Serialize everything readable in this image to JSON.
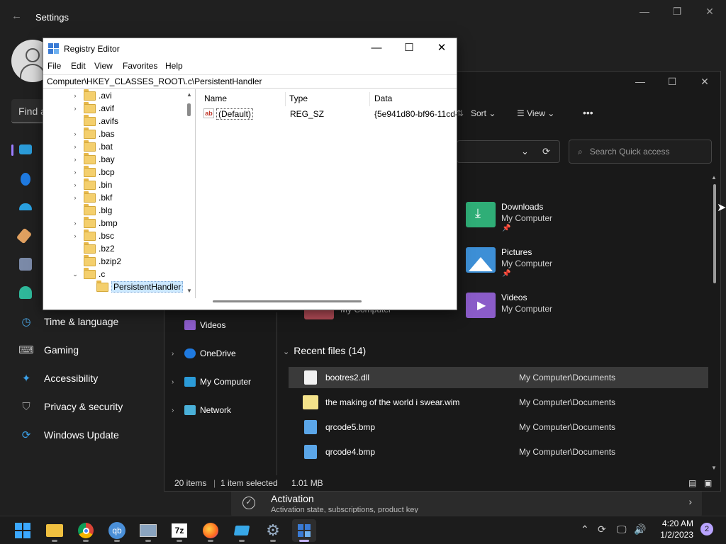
{
  "settings": {
    "title": "Settings",
    "search_placeholder": "Find a",
    "nav": [
      {
        "label": "Time & language"
      },
      {
        "label": "Gaming"
      },
      {
        "label": "Accessibility"
      },
      {
        "label": "Privacy & security"
      },
      {
        "label": "Windows Update"
      }
    ],
    "activation": {
      "title": "Activation",
      "subtitle": "Activation state, subscriptions, product key"
    }
  },
  "explorer": {
    "toolbar": {
      "sort": "Sort",
      "view": "View",
      "more": "•••"
    },
    "search_placeholder": "Search Quick access",
    "quick_access": [
      {
        "name": "Downloads",
        "location": "My Computer",
        "icon": "downloads-folder-icon",
        "color": "#2fae77"
      },
      {
        "name": "Pictures",
        "location": "My Computer",
        "icon": "pictures-folder-icon",
        "color": "#3d8fd6"
      },
      {
        "name": "Videos",
        "location": "My Computer",
        "icon": "videos-folder-icon",
        "color": "#8b5cc9"
      }
    ],
    "partial_item": {
      "location": "My Computer"
    },
    "nav": [
      {
        "label": "Videos"
      },
      {
        "label": "OneDrive"
      },
      {
        "label": "My Computer"
      },
      {
        "label": "Network"
      }
    ],
    "recent_header": "Recent files (14)",
    "recent_files": [
      {
        "name": "bootres2.dll",
        "path": "My Computer\\Documents",
        "icon": "dll-file-icon"
      },
      {
        "name": "the making of the world i swear.wim",
        "path": "My Computer\\Documents",
        "icon": "wim-file-icon"
      },
      {
        "name": "qrcode5.bmp",
        "path": "My Computer\\Documents",
        "icon": "bmp-file-icon"
      },
      {
        "name": "qrcode4.bmp",
        "path": "My Computer\\Documents",
        "icon": "bmp-file-icon"
      }
    ],
    "status": {
      "items": "20 items",
      "selected": "1 item selected",
      "size": "1.01 MB"
    }
  },
  "regedit": {
    "title": "Registry Editor",
    "menu": [
      "File",
      "Edit",
      "View",
      "Favorites",
      "Help"
    ],
    "address": "Computer\\HKEY_CLASSES_ROOT\\.c\\PersistentHandler",
    "tree": [
      {
        "label": ".avi",
        "expander": "›"
      },
      {
        "label": ".avif",
        "expander": "›"
      },
      {
        "label": ".avifs",
        "expander": ""
      },
      {
        "label": ".bas",
        "expander": "›"
      },
      {
        "label": ".bat",
        "expander": "›"
      },
      {
        "label": ".bay",
        "expander": "›"
      },
      {
        "label": ".bcp",
        "expander": "›"
      },
      {
        "label": ".bin",
        "expander": "›"
      },
      {
        "label": ".bkf",
        "expander": "›"
      },
      {
        "label": ".blg",
        "expander": ""
      },
      {
        "label": ".bmp",
        "expander": "›"
      },
      {
        "label": ".bsc",
        "expander": "›"
      },
      {
        "label": ".bz2",
        "expander": ""
      },
      {
        "label": ".bzip2",
        "expander": ""
      },
      {
        "label": ".c",
        "expander": "⌄"
      },
      {
        "label": "PersistentHandler",
        "expander": ""
      }
    ],
    "columns": {
      "name": "Name",
      "type": "Type",
      "data": "Data"
    },
    "values": [
      {
        "name": "(Default)",
        "type": "REG_SZ",
        "data": "{5e941d80-bf96-11cd-"
      }
    ]
  },
  "taskbar": {
    "apps": [
      {
        "name": "start",
        "icon": "windows-start-icon"
      },
      {
        "name": "file-explorer",
        "icon": "folder-icon"
      },
      {
        "name": "chrome",
        "icon": "chrome-icon"
      },
      {
        "name": "qbittorrent",
        "icon": "qbittorrent-icon"
      },
      {
        "name": "resource-monitor",
        "icon": "monitor-icon"
      },
      {
        "name": "7zip",
        "icon": "7zip-icon"
      },
      {
        "name": "firefox",
        "icon": "firefox-icon"
      },
      {
        "name": "app",
        "icon": "blue-app-icon"
      },
      {
        "name": "settings",
        "icon": "gear-icon"
      },
      {
        "name": "registry-editor",
        "icon": "regedit-icon"
      }
    ],
    "qb_label": "qb",
    "seven_zip_label": "7z",
    "time": "4:20 AM",
    "date": "1/2/2023",
    "notification_count": "2"
  }
}
